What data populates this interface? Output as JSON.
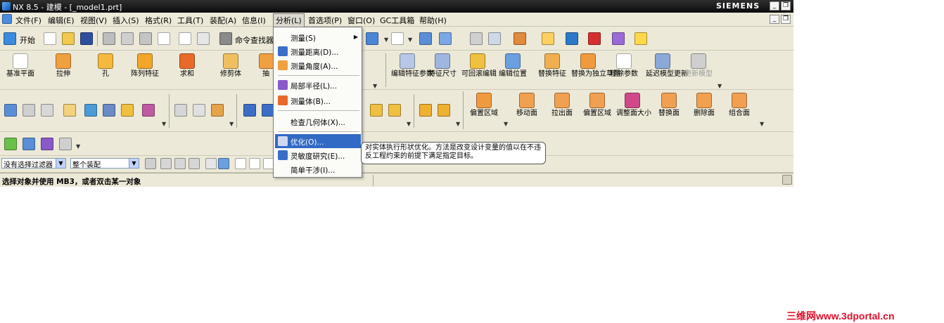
{
  "window": {
    "title": "NX 8.5 - 建模 - [_model1.prt]",
    "brand": "SIEMENS"
  },
  "menubar": {
    "items": [
      "文件(F)",
      "编辑(E)",
      "视图(V)",
      "插入(S)",
      "格式(R)",
      "工具(T)",
      "装配(A)",
      "信息(I)",
      "分析(L)",
      "首选项(P)",
      "窗口(O)",
      "GC工具箱",
      "帮助(H)"
    ],
    "active": "分析(L)"
  },
  "toolbar_standard": {
    "start_label": "开始",
    "command_finder_label": "命令查找器"
  },
  "toolbar_features": {
    "buttons": [
      {
        "label": "基准平面",
        "icon": "datum-plane-icon"
      },
      {
        "label": "拉伸",
        "icon": "extrude-icon"
      },
      {
        "label": "孔",
        "icon": "hole-icon"
      },
      {
        "label": "阵列特征",
        "icon": "pattern-feature-icon"
      },
      {
        "label": "求和",
        "icon": "unite-icon"
      },
      {
        "label": "修剪体",
        "icon": "trim-body-icon"
      },
      {
        "label": "抽",
        "icon": "shell-icon"
      }
    ],
    "buttons_right": [
      {
        "label": "编辑特征参数",
        "icon": "edit-feature-parameters-icon"
      },
      {
        "label": "特征尺寸",
        "icon": "feature-dimension-icon"
      },
      {
        "label": "可回滚编辑",
        "icon": "rollback-edit-icon"
      },
      {
        "label": "编辑位置",
        "icon": "edit-position-icon"
      },
      {
        "label": "替换特征",
        "icon": "replace-feature-icon"
      },
      {
        "label": "替换为独立草图",
        "icon": "replace-with-sketch-icon"
      },
      {
        "label": "移除参数",
        "icon": "remove-parameters-icon"
      },
      {
        "label": "延迟模型更新",
        "icon": "delay-update-icon"
      },
      {
        "label": "更新模型",
        "icon": "update-model-icon"
      }
    ]
  },
  "toolbar_sync": {
    "buttons": [
      {
        "label": "偏置区域",
        "icon": "offset-region-icon"
      },
      {
        "label": "移动面",
        "icon": "move-face-icon"
      },
      {
        "label": "拉出面",
        "icon": "pull-face-icon"
      },
      {
        "label": "偏置区域",
        "icon": "offset-region-2-icon"
      },
      {
        "label": "调整面大小",
        "icon": "resize-face-icon"
      },
      {
        "label": "替换面",
        "icon": "replace-face-icon"
      },
      {
        "label": "删除面",
        "icon": "delete-face-icon"
      },
      {
        "label": "组合面",
        "icon": "group-face-icon"
      }
    ]
  },
  "selection_bar": {
    "filter": "没有选择过滤器",
    "scope": "整个装配"
  },
  "analysis_menu": {
    "items": [
      {
        "label": "测量(S)",
        "submenu": true
      },
      {
        "label": "测量距离(D)..."
      },
      {
        "label": "测量角度(A)..."
      },
      {
        "label": "局部半径(L)..."
      },
      {
        "label": "测量体(B)..."
      },
      {
        "label": "检查几何体(X)..."
      },
      {
        "label": "优化(O)...",
        "highlighted": true
      },
      {
        "label": "灵敏度研究(E)..."
      },
      {
        "label": "简单干涉(I)..."
      }
    ]
  },
  "tooltip": {
    "line1": "对实体执行形状优化。方法是改变设计变量的值以在不违",
    "line2": "反工程约束的前提下满足指定目标。"
  },
  "status": {
    "message": "选择对象并使用 MB3，或者双击某一对象"
  },
  "watermark": "三维网www.3dportal.cn",
  "colors": {
    "highlight": "#316ac5",
    "chrome": "#ece9d8",
    "titlebar": "#111111",
    "watermark": "#e0102a"
  }
}
